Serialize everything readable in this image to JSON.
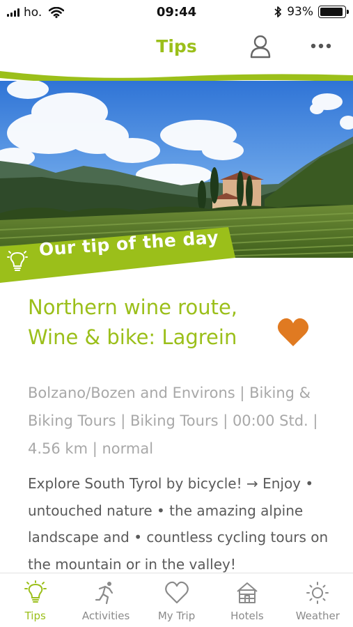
{
  "status_bar": {
    "carrier": "ho.",
    "time": "09:44",
    "battery_percent": 93,
    "battery_label": "93%"
  },
  "header": {
    "title": "Tips"
  },
  "banner": {
    "label": "Our tip of the day"
  },
  "tour": {
    "title_line1": "Northern wine route,",
    "title_line2": "Wine & bike: Lagrein",
    "meta": "Bolzano/Bozen and Environs | Biking & Biking Tours | Biking Tours | 00:00 Std. | 4.56 km | normal",
    "description": "Explore South Tyrol by bicycle! → Enjoy • untouched nature • the amazing alpine landscape and • countless cycling tours on the mountain or in the valley!",
    "favorite": true
  },
  "tabs": [
    {
      "label": "Tips",
      "icon": "lightbulb-icon",
      "active": true
    },
    {
      "label": "Activities",
      "icon": "runner-icon",
      "active": false
    },
    {
      "label": "My Trip",
      "icon": "heart-icon",
      "active": false
    },
    {
      "label": "Hotels",
      "icon": "house-icon",
      "active": false
    },
    {
      "label": "Weather",
      "icon": "sun-icon",
      "active": false
    }
  ],
  "colors": {
    "accent": "#9bbf1a",
    "favorite": "#e07a21",
    "inactive": "#8a8a8a"
  }
}
